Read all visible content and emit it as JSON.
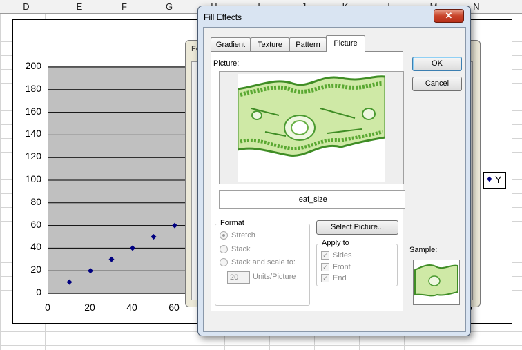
{
  "sheet": {
    "columns": [
      "D",
      "E",
      "F",
      "G",
      "H",
      "I",
      "J",
      "K",
      "L",
      "M",
      "N"
    ]
  },
  "chart": {
    "y_ticks": [
      "200",
      "180",
      "160",
      "140",
      "120",
      "100",
      "80",
      "60",
      "40",
      "20",
      "0"
    ],
    "x_ticks": [
      "0",
      "20",
      "40",
      "60"
    ],
    "x_tick_right": "0",
    "legend_label": "Y",
    "marker_color": "#000080",
    "plot_bg": "#c0c0c0"
  },
  "chart_data": {
    "type": "scatter",
    "series": [
      {
        "x": [
          10,
          20,
          30,
          40,
          50,
          60
        ],
        "y": [
          10,
          20,
          30,
          40,
          50,
          60
        ]
      }
    ],
    "ylim": [
      0,
      200
    ],
    "yticks": [
      0,
      20,
      40,
      60,
      80,
      100,
      120,
      140,
      160,
      180,
      200
    ],
    "xticks": [
      0,
      20,
      40,
      60
    ],
    "grid": true,
    "legend_placement": "right"
  },
  "format_dialog": {
    "title": "Fo"
  },
  "fill_effects": {
    "title": "Fill Effects",
    "close_label": "✕",
    "tabs": [
      "Gradient",
      "Texture",
      "Pattern",
      "Picture"
    ],
    "active_tab": "Picture",
    "picture_label": "Picture:",
    "file_name": "leaf_size",
    "format": {
      "title": "Format",
      "options": [
        "Stretch",
        "Stack",
        "Stack and scale to:"
      ],
      "selected": "Stretch",
      "scale_value": "20",
      "units_label": "Units/Picture"
    },
    "select_picture_label": "Select Picture...",
    "apply_to": {
      "title": "Apply to",
      "options": [
        "Sides",
        "Front",
        "End"
      ]
    },
    "ok_label": "OK",
    "cancel_label": "Cancel",
    "sample_label": "Sample:"
  }
}
